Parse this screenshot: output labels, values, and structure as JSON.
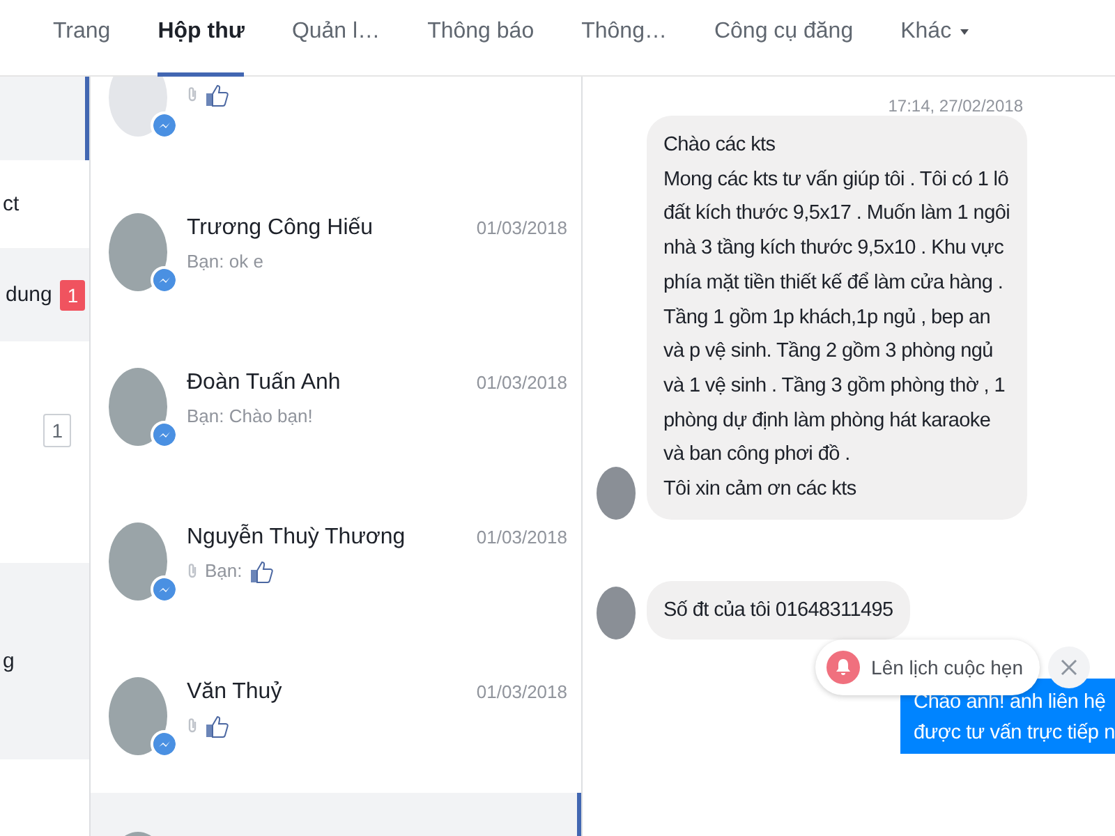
{
  "nav": {
    "tabs": [
      {
        "label": "Trang",
        "selected": false
      },
      {
        "label": "Hộp thư",
        "selected": true
      },
      {
        "label": "Quản l…",
        "selected": false
      },
      {
        "label": "Thông báo",
        "selected": false
      },
      {
        "label": "Thông…",
        "selected": false
      },
      {
        "label": "Công cụ đăng",
        "selected": false
      },
      {
        "label": "Khác",
        "selected": false,
        "dropdown": true
      }
    ]
  },
  "sidebar": {
    "items": [
      {
        "selected": true
      },
      {
        "label": "ct",
        "selected": false
      },
      {
        "label": "dung",
        "selected": false,
        "badge": "1",
        "kind": "filled"
      },
      {
        "selected": false,
        "badge": "1",
        "kind": "outline"
      },
      {
        "label": "g",
        "selected": false
      }
    ]
  },
  "conversations": [
    {
      "has_photo": false,
      "kind": "like",
      "selected": false
    },
    {
      "has_photo": true,
      "name": "Trương Công Hiếu",
      "date": "01/03/2018",
      "preview": "Bạn: ok e",
      "kind": "text",
      "selected": false
    },
    {
      "has_photo": true,
      "name": "Đoàn Tuấn Anh",
      "date": "01/03/2018",
      "preview": "Bạn: Chào bạn!",
      "kind": "text",
      "selected": false
    },
    {
      "has_photo": true,
      "name": "Nguyễn Thuỳ Thương",
      "date": "01/03/2018",
      "preview": "Bạn:",
      "kind": "like",
      "selected": false
    },
    {
      "has_photo": true,
      "name": "Văn Thuỷ",
      "date": "01/03/2018",
      "kind": "like",
      "selected": false
    },
    {
      "has_photo": true,
      "selected": true
    }
  ],
  "chat": {
    "timestamp": "17:14, 27/02/2018",
    "messages": [
      {
        "kind": "incoming",
        "text": "Chào các kts\nMong các kts tư vấn giúp tôi . Tôi có 1 lô\nđất kích thước 9,5x17 . Muốn làm 1 ngôi\nnhà 3 tầng kích thước 9,5x10 . Khu vực\nphía mặt tiền thiết kế để làm cửa hàng .\nTầng 1 gồm 1p khách,1p ngủ ,  bep an\nvà p vệ sinh. Tầng 2 gồm 3 phòng ngủ\nvà 1 vệ sinh . Tầng 3 gồm phòng thờ , 1\nphòng dự định làm phòng hát karaoke\nvà ban công phơi đồ .\nTôi xin cảm ơn các kts"
      },
      {
        "kind": "incoming",
        "text": "Số đt của tôi 01648311495"
      },
      {
        "kind": "outgoing",
        "text": "Chào anh! anh liên hệ\nđược tư vấn trực tiếp n"
      }
    ],
    "schedule_prompt": {
      "label": "Lên lịch cuộc hẹn"
    }
  }
}
